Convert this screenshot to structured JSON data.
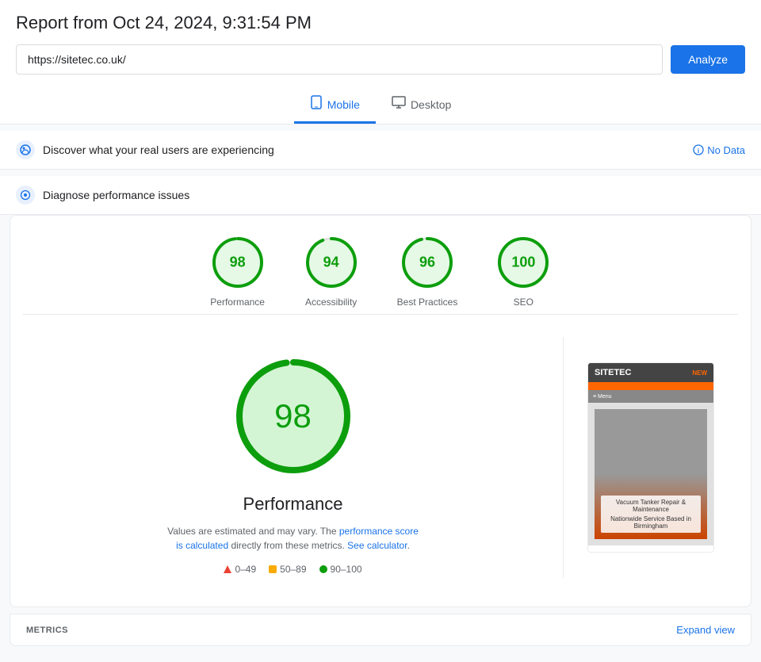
{
  "header": {
    "title": "Report from Oct 24, 2024, 9:31:54 PM",
    "url": "https://sitetec.co.uk/",
    "analyze_label": "Analyze"
  },
  "tabs": [
    {
      "id": "mobile",
      "label": "Mobile",
      "active": true
    },
    {
      "id": "desktop",
      "label": "Desktop",
      "active": false
    }
  ],
  "crux_section": {
    "title": "Discover what your real users are experiencing",
    "no_data_label": "No Data"
  },
  "diagnose_section": {
    "title": "Diagnose performance issues"
  },
  "scores": [
    {
      "id": "performance",
      "value": 98,
      "label": "Performance",
      "color": "#0d9e0d",
      "r": 30
    },
    {
      "id": "accessibility",
      "value": 94,
      "label": "Accessibility",
      "color": "#0d9e0d",
      "r": 30
    },
    {
      "id": "best-practices",
      "value": 96,
      "label": "Best Practices",
      "color": "#0d9e0d",
      "r": 30
    },
    {
      "id": "seo",
      "value": 100,
      "label": "SEO",
      "color": "#0d9e0d",
      "r": 30
    }
  ],
  "big_score": {
    "value": 98,
    "label": "Performance",
    "color": "#0d9e0d"
  },
  "perf_desc": {
    "text_before": "Values are estimated and may vary. The ",
    "link1": "performance score is calculated",
    "text_middle": " directly from these metrics. ",
    "link2": "See calculator",
    "text_after": "."
  },
  "legend": [
    {
      "type": "triangle",
      "range": "0–49",
      "color": "#ea4335"
    },
    {
      "type": "square",
      "range": "50–89",
      "color": "#f9ab00"
    },
    {
      "type": "circle",
      "range": "90–100",
      "color": "#0d9e0d"
    }
  ],
  "screenshot": {
    "site_name": "SITETEC",
    "tagline": "Vacuum Tanker Repair &\nMaintenance",
    "sub": "Nationwide Service Based in\nBirmingham"
  },
  "footer": {
    "metrics_label": "METRICS",
    "expand_label": "Expand view"
  }
}
